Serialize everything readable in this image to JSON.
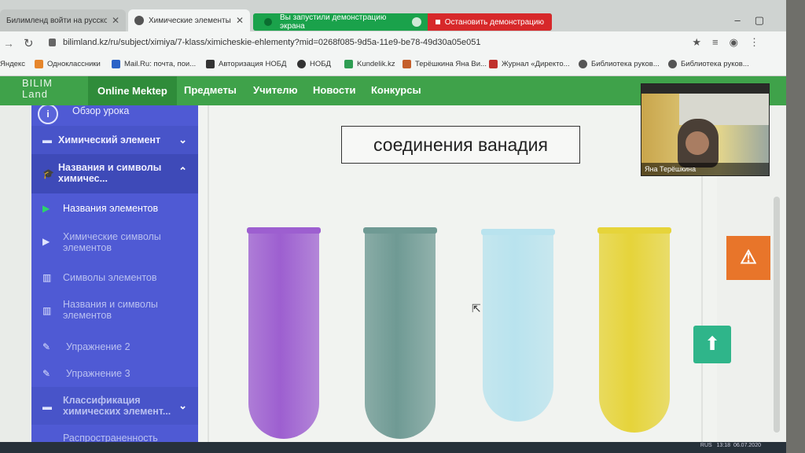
{
  "browser": {
    "tabs": [
      {
        "title": "Билимленд войти на русском - ...",
        "active": false
      },
      {
        "title": "Химические элементы – Хи...",
        "active": true
      }
    ],
    "demo_notice": "Вы запустили демонстрацию экрана",
    "demo_stop": "Остановить демонстрацию",
    "url": "bilimland.kz/ru/subject/ximiya/7-klass/ximicheskie-ehlementy?mid=0268f085-9d5a-11e9-be78-49d30a05e051",
    "bookmarks": [
      {
        "label": "Яндекс",
        "color": "#cc3b2c"
      },
      {
        "label": "Одноклассники",
        "color": "#e6862c"
      },
      {
        "label": "Mail.Ru: почта, пои...",
        "color": "#2b63c7"
      },
      {
        "label": "Авторизация НОБД",
        "color": "#333333"
      },
      {
        "label": "НОБД",
        "color": "#333333"
      },
      {
        "label": "Kundelik.kz",
        "color": "#2e9d52"
      },
      {
        "label": "Терёшкина Яна Ви...",
        "color": "#c45e2a"
      },
      {
        "label": "Журнал «Директо...",
        "color": "#c0302c"
      },
      {
        "label": "Библиотека руков...",
        "color": "#555555"
      },
      {
        "label": "Библиотека руков...",
        "color": "#555555"
      }
    ]
  },
  "site": {
    "logo": "BILIM Land",
    "nav": [
      "Online Mektep",
      "Предметы",
      "Учителю",
      "Новости",
      "Конкурсы"
    ]
  },
  "sidebar": {
    "items": [
      {
        "label": "Обзор урока",
        "icon": "info-icon"
      },
      {
        "label": "Химический элемент",
        "icon": "list-icon",
        "chevron": "down"
      },
      {
        "label": "Названия и символы химичес...",
        "icon": "graduation-cap-icon",
        "chevron": "up"
      },
      {
        "label": "Названия элементов",
        "icon": "play-icon"
      },
      {
        "label": "Химические символы элементов",
        "icon": "play-icon"
      },
      {
        "label": "Символы элементов",
        "icon": "book-icon"
      },
      {
        "label": "Названия и символы элементов",
        "icon": "book-icon"
      },
      {
        "label": "Упражнение 2",
        "icon": "edit-icon"
      },
      {
        "label": "Упражнение 3",
        "icon": "edit-icon"
      },
      {
        "label": "Классификация химических элемент...",
        "icon": "list-icon",
        "chevron": "down"
      },
      {
        "label": "Распространенность",
        "icon": "list-icon",
        "chevron": "down"
      }
    ]
  },
  "content": {
    "title": "соединения ванадия",
    "tubes": [
      {
        "color": "#9d5fd0"
      },
      {
        "color": "#6f9a94"
      },
      {
        "color": "#b9e3ee"
      },
      {
        "color": "#e6d43a"
      }
    ]
  },
  "video": {
    "participant": "Яна Терёшкина"
  },
  "taskbar": {
    "lang": "RUS",
    "time": "13:18",
    "date": "06.07.2020"
  }
}
